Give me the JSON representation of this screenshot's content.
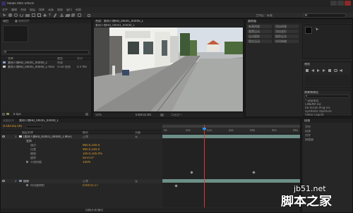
{
  "window": {
    "title": "Adobe After Effects"
  },
  "menu": {
    "items": [
      "文件",
      "编辑",
      "合成",
      "图层",
      "效果",
      "动画",
      "视图",
      "窗口",
      "帮助"
    ]
  },
  "project": {
    "tab": "项目",
    "search_placeholder": "",
    "columns": {
      "name": "名称",
      "type": "类型",
      "size": "大小"
    },
    "items": [
      {
        "name": "素材人物HD_00001_00000_1",
        "type": "合成",
        "size": ""
      },
      {
        "name": "素材人物HD_00001_00000_1.mov",
        "type": "Fluid 视频",
        "size": "4.0 MB"
      }
    ],
    "bpc": "8 bpc"
  },
  "viewer": {
    "tab": "合成：素材人物HD_00001_00000_1",
    "zoom": "50%",
    "quality": "二分之一",
    "timecode": "0:00:01:00"
  },
  "right_panel": {
    "tab": "工作区：标准",
    "buttons": [
      "新建网格",
      "添加网格",
      "重置运动",
      "添加变形",
      "运动跟踪",
      "跟踪运动",
      "稳定运动",
      "时间伸缩"
    ],
    "preview_tab": "预览",
    "effects_tab": "效果和预设",
    "effects_items": [
      "* 动画预设",
      "CINEMA 4D",
      "RE:Vision Plug-ins",
      "Synthetic Aperture",
      "Video Copilot",
      "实用工具",
      "风格化"
    ]
  },
  "timeline": {
    "tab": "素材人物HD_00001_00000_1",
    "timecode": "0:00:01:00",
    "col_layer": "图层名称",
    "col_mode": "模式",
    "col_parent": "父级",
    "layers": [
      {
        "num": "1",
        "name": "[素材人物HD_00001_00000_1.Mov]",
        "mode": "正常",
        "parent": "无"
      },
      {
        "num": "",
        "name": "变换",
        "mode": "",
        "parent": ""
      },
      {
        "num": "",
        "name": "锚点",
        "mode": "960.0,540.0",
        "parent": ""
      },
      {
        "num": "",
        "name": "位置",
        "mode": "960.0,540.0",
        "parent": ""
      },
      {
        "num": "",
        "name": "缩放",
        "mode": "100.0,100.0%",
        "parent": ""
      },
      {
        "num": "",
        "name": "旋转",
        "mode": "0x+0.0°",
        "parent": ""
      },
      {
        "num": "",
        "name": "不透明度",
        "mode": "100%",
        "parent": ""
      },
      {
        "num": "2",
        "name": "摄像",
        "mode": "正常",
        "parent": "无"
      },
      {
        "num": "",
        "name": "时间重映射",
        "mode": "0:00:01:17",
        "parent": ""
      }
    ],
    "ruler_labels": [
      "0s",
      "01s",
      "02s",
      "03s",
      "04s",
      "05s",
      "06s"
    ],
    "playhead_fraction": 0.3,
    "footer_label": "切换开关/模式"
  },
  "rightbottom": {
    "tab": "段落",
    "items": [
      "字符",
      "段落",
      "对齐",
      "摇摆器"
    ]
  },
  "watermark": {
    "line1": "jb51.net",
    "line2": "脚本之家"
  },
  "colors": {
    "bg": "#1e1e1e",
    "panel": "#262626",
    "accent_blue": "#2d8ceb",
    "playhead": "#e0372e",
    "track": "#6c8f87",
    "timecode": "#e6a22a"
  }
}
